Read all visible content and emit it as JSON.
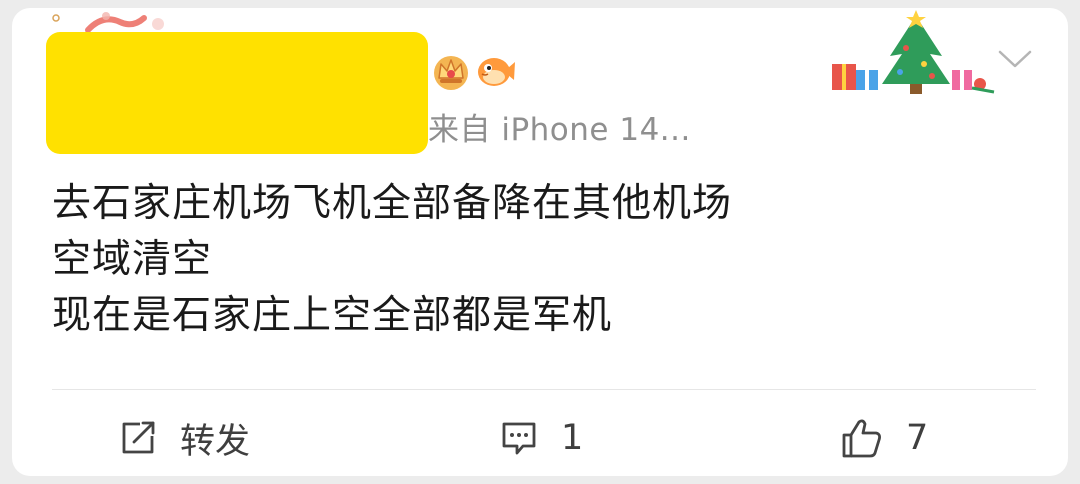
{
  "post": {
    "source": "来自 iPhone 14...",
    "body_lines": [
      "去石家庄机场飞机全部备降在其他机场",
      "空域清空",
      "现在是石家庄上空全部都是军机"
    ]
  },
  "icons": {
    "badges": [
      "crown-icon",
      "pufferfish-icon"
    ],
    "header_decoration": "christmas-tree-icon",
    "menu": "chevron-down-icon"
  },
  "actions": {
    "repost": {
      "icon": "repost-icon",
      "label": "转发"
    },
    "comment": {
      "icon": "comment-icon",
      "count": "1"
    },
    "like": {
      "icon": "thumbs-up-icon",
      "count": "7"
    }
  },
  "colors": {
    "redaction": "#ffe100",
    "text": "#1a1a1a",
    "meta": "#8f8f8f",
    "action_text": "#3f3f3f"
  }
}
